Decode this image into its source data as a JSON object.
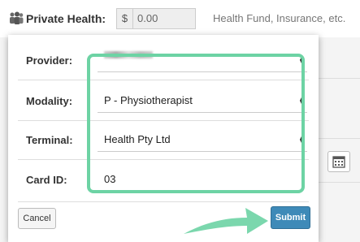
{
  "background": {
    "section_title": "Private Health:",
    "currency_symbol": "$",
    "amount_value": "0.00",
    "hint_text": "Health Fund, Insurance, etc."
  },
  "modal": {
    "provider": {
      "label": "Provider:",
      "value": ""
    },
    "modality": {
      "label": "Modality:",
      "value": "P - Physiotherapist"
    },
    "terminal": {
      "label": "Terminal:",
      "value": "Health Pty Ltd"
    },
    "card_id": {
      "label": "Card ID:",
      "value": "03"
    },
    "cancel_label": "Cancel",
    "submit_label": "Submit"
  },
  "colors": {
    "highlight": "#6dd3a4",
    "submit": "#3e8ab8"
  },
  "icons": [
    "people-icon",
    "calendar-icon",
    "select-arrows-icon",
    "pointer-arrow-icon"
  ]
}
